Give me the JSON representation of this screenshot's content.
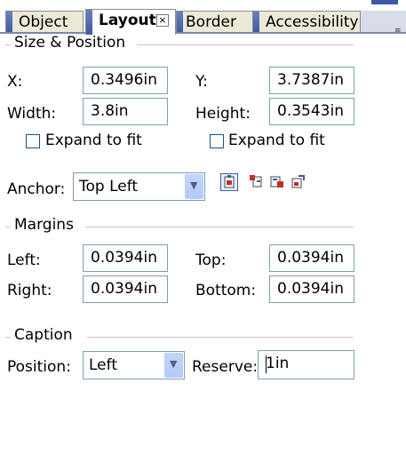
{
  "tabs": [
    {
      "label": "Object"
    },
    {
      "label": "Layout"
    },
    {
      "label": "Border"
    },
    {
      "label": "Accessibility"
    }
  ],
  "groups": {
    "size_position": "Size & Position",
    "margins": "Margins",
    "caption": "Caption"
  },
  "size_position": {
    "x_label": "X:",
    "x_value": "0.3496in",
    "y_label": "Y:",
    "y_value": "3.7387in",
    "width_label": "Width:",
    "width_value": "3.8in",
    "height_label": "Height:",
    "height_value": "0.3543in",
    "expand_width_label": "Expand to fit",
    "expand_height_label": "Expand to fit",
    "anchor_label": "Anchor:",
    "anchor_value": "Top Left"
  },
  "margins": {
    "left_label": "Left:",
    "left_value": "0.0394in",
    "top_label": "Top:",
    "top_value": "0.0394in",
    "right_label": "Right:",
    "right_value": "0.0394in",
    "bottom_label": "Bottom:",
    "bottom_value": "0.0394in"
  },
  "caption": {
    "position_label": "Position:",
    "position_value": "Left",
    "reserve_label": "Reserve:",
    "reserve_value": "1in"
  },
  "icons": [
    "close-tab-icon",
    "anchor-layout-icon",
    "anchor-move-icon",
    "anchor-resize-icon",
    "anchor-edit-icon",
    "overflow-menu-icon"
  ],
  "colors": {
    "accent": "#3b5aa8",
    "field_border": "#7f9db9",
    "dropdown_button": "#b2c8f8"
  }
}
